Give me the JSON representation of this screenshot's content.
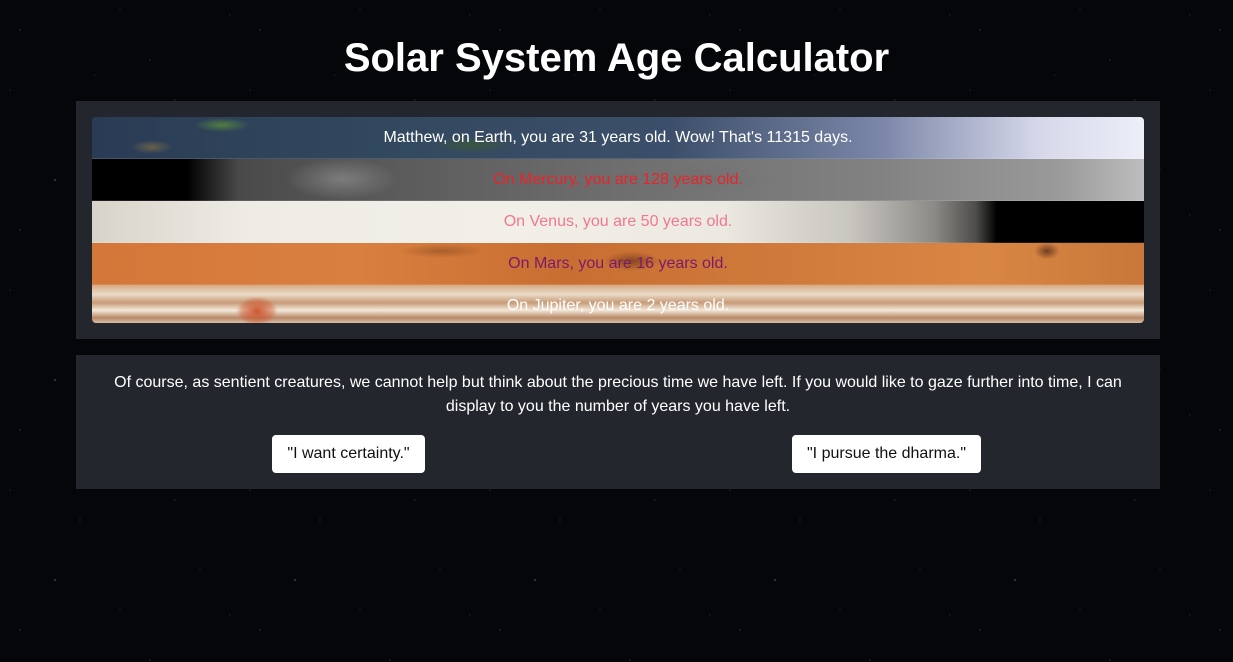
{
  "page": {
    "title": "Solar System Age Calculator"
  },
  "results": [
    {
      "planet": "Earth",
      "text": "Matthew, on Earth, you are 31 years old. Wow! That's 11315 days.",
      "text_color": "#ffffff"
    },
    {
      "planet": "Mercury",
      "text": "On Mercury, you are 128 years old.",
      "text_color": "#e8242a"
    },
    {
      "planet": "Venus",
      "text": "On Venus, you are 50 years old.",
      "text_color": "#f07890"
    },
    {
      "planet": "Mars",
      "text": "On Mars, you are 16 years old.",
      "text_color": "#7c1a6a"
    },
    {
      "planet": "Jupiter",
      "text": "On Jupiter, you are 2 years old.",
      "text_color": "#ffffff"
    }
  ],
  "remaining": {
    "text": "Of course, as sentient creatures, we cannot help but think about the precious time we have left. If you would like to gaze further into time, I can display to you the number of years you have left.",
    "buttons": {
      "certainty": "\"I want certainty.\"",
      "dharma": "\"I pursue the dharma.\""
    }
  },
  "colors": {
    "background": "#05060a",
    "panel": "#23272d",
    "button": "#ffffff"
  }
}
